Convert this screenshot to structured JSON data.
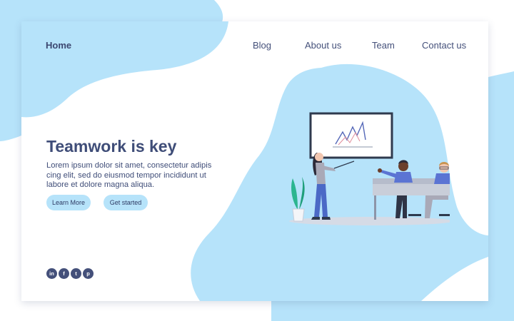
{
  "colors": {
    "blob": "#b6e3fa",
    "text_dark": "#3f4d78",
    "card": "#ffffff",
    "button": "#b6e3fa"
  },
  "nav": {
    "home": "Home",
    "blog": "Blog",
    "about": "About us",
    "team": "Team",
    "contact": "Contact us"
  },
  "hero": {
    "title": "Teamwork is key",
    "body": "Lorem ipsum dolor sit amet, consectetur adipis cing elit, sed do eiusmod tempor incididunt ut labore et dolore magna aliqua.",
    "buttons": {
      "learn_more": "Learn More",
      "get_started": "Get started"
    }
  },
  "social": [
    {
      "icon": "linkedin-icon",
      "glyph": "in"
    },
    {
      "icon": "facebook-icon",
      "glyph": "f"
    },
    {
      "icon": "twitter-icon",
      "glyph": "t"
    },
    {
      "icon": "pinterest-icon",
      "glyph": "p"
    }
  ]
}
